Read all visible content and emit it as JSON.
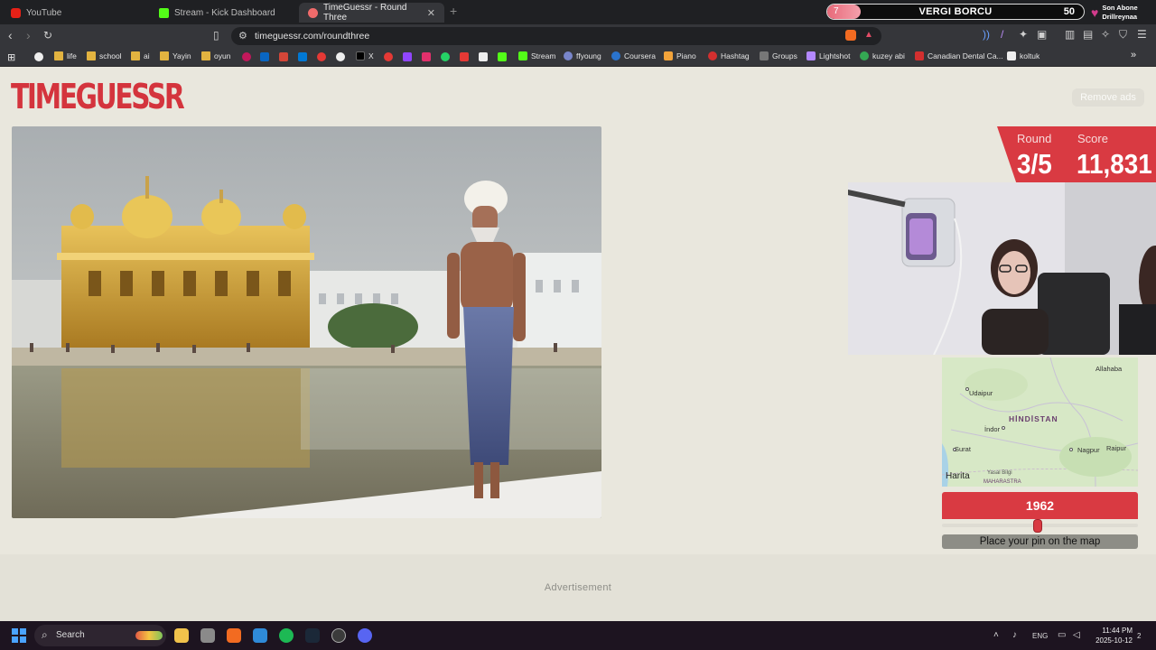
{
  "browser": {
    "tabs": [
      {
        "title": "YouTube",
        "icon": "youtube-icon",
        "active": false
      },
      {
        "title": "Stream - Kick Dashboard",
        "icon": "kick-icon",
        "active": false
      },
      {
        "title": "TimeGuessr - Round Three",
        "icon": "timeguessr-icon",
        "active": true
      }
    ],
    "url": "timeguessr.com/roundthree",
    "bookmarks": [
      "life",
      "school",
      "ai",
      "Yayin",
      "oyun",
      "X",
      "Stream",
      "ffyoung",
      "Coursera",
      "Piano",
      "Hashtag",
      "Groups",
      "Lightshot",
      "kuzey abi",
      "Canadian Dental Ca...",
      "koltuk"
    ]
  },
  "overlay": {
    "goal_level": "7",
    "goal_label": "VERGI BORCU",
    "goal_value": "50",
    "goal_progress": 0.13,
    "son_abone_title": "Son Abone",
    "son_abone_name": "Drillreynaa"
  },
  "game": {
    "logo": "TIMEGUESSR",
    "remove_ads": "Remove ads",
    "round_label": "Round",
    "round_value": "3/5",
    "score_label": "Score",
    "score_value": "11,831",
    "year": "1962",
    "year_slider_fraction": 0.49,
    "place_pin": "Place your pin on the map",
    "advertisement": "Advertisement"
  },
  "map": {
    "country": "HİNDİSTAN",
    "cities": [
      "Allahaba",
      "Udaipur",
      "İndor",
      "Surat",
      "Nagpur",
      "Raipur",
      "MAHARASTRA"
    ],
    "harita_label": "Harita",
    "attribution": "Yasal Bilgi"
  },
  "taskbar": {
    "search": "Search",
    "lang": "ENG",
    "time": "11:44 PM",
    "date": "2025-10-12",
    "notifications": "2"
  },
  "colors": {
    "accent": "#d93a42",
    "page_bg": "#e9e7dd"
  }
}
